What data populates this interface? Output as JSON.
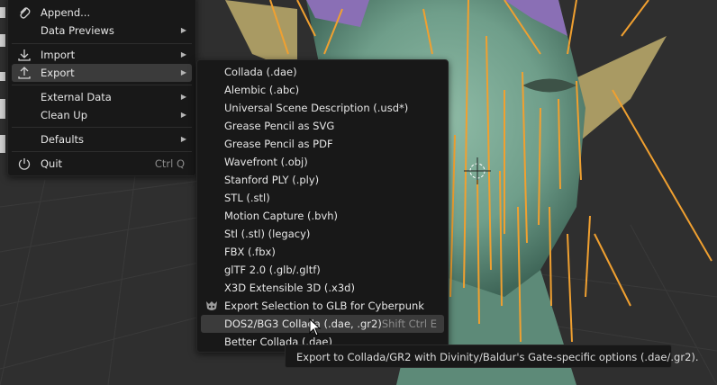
{
  "file_menu": {
    "items": [
      {
        "label": "Append...",
        "icon": "paperclip-icon"
      },
      {
        "label": "Data Previews",
        "submenu": true
      },
      {
        "label": "Import",
        "icon": "import-icon",
        "submenu": true
      },
      {
        "label": "Export",
        "icon": "export-icon",
        "submenu": true,
        "active": true
      },
      {
        "label": "External Data",
        "submenu": true
      },
      {
        "label": "Clean Up",
        "submenu": true
      },
      {
        "label": "Defaults",
        "submenu": true
      },
      {
        "label": "Quit",
        "icon": "power-icon",
        "shortcut": "Ctrl Q"
      }
    ]
  },
  "export_menu": {
    "items": [
      {
        "label": "Collada (.dae)"
      },
      {
        "label": "Alembic (.abc)"
      },
      {
        "label": "Universal Scene Description (.usd*)"
      },
      {
        "label": "Grease Pencil as SVG"
      },
      {
        "label": "Grease Pencil as PDF"
      },
      {
        "label": "Wavefront (.obj)"
      },
      {
        "label": "Stanford PLY (.ply)"
      },
      {
        "label": "STL (.stl)"
      },
      {
        "label": "Motion Capture (.bvh)"
      },
      {
        "label": "Stl (.stl) (legacy)"
      },
      {
        "label": "FBX (.fbx)"
      },
      {
        "label": "glTF 2.0 (.glb/.gltf)"
      },
      {
        "label": "X3D Extensible 3D (.x3d)"
      },
      {
        "label": "Export Selection to GLB for Cyberpunk",
        "icon": "cyberpunk-icon"
      },
      {
        "label": "DOS2/BG3 Collada (.dae, .gr2)",
        "shortcut": "Shift Ctrl E",
        "highlighted": true
      },
      {
        "label": "Better Collada (.dae)"
      }
    ]
  },
  "tooltip": {
    "text": "Export to Collada/GR2 with Divinity/Baldur's Gate-specific options (.dae/.gr2)."
  },
  "colors": {
    "menu_bg": "#181818",
    "highlight": "#3b3b3b",
    "viewport_bg": "#2f2f2f",
    "skin": "#6f9e8a",
    "hair_strands": "#f0a030"
  }
}
